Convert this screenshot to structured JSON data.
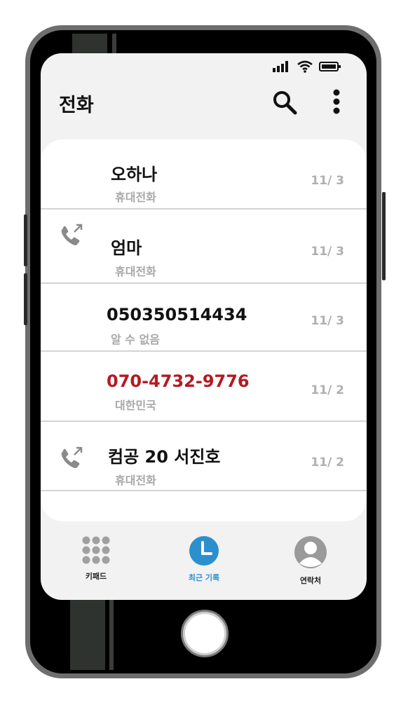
{
  "app": {
    "title": "전화"
  },
  "header": {
    "search_icon": "search-icon",
    "more_icon": "more-vertical-icon"
  },
  "status_bar": {
    "icons": [
      "signal-icon",
      "wifi-icon",
      "battery-icon"
    ]
  },
  "calls": [
    {
      "name": "오하나",
      "type": "휴대전화",
      "date": "11/ 3",
      "outgoing": false,
      "missed": false
    },
    {
      "name": "엄마",
      "type": "휴대전화",
      "date": "11/ 3",
      "outgoing": true,
      "missed": false
    },
    {
      "name": "050350514434",
      "type": "알 수 없음",
      "date": "11/ 3",
      "outgoing": false,
      "missed": false
    },
    {
      "name": "070-4732-9776",
      "type": "대한민국",
      "date": "11/ 2",
      "outgoing": false,
      "missed": true
    },
    {
      "name": "컴공 20 서진호",
      "type": "휴대전화",
      "date": "11/ 2",
      "outgoing": true,
      "missed": false
    }
  ],
  "nav": {
    "keypad": "키패드",
    "recents": "최근 기록",
    "contacts": "연락처",
    "active": "recents"
  },
  "colors": {
    "missed": "#b31b22",
    "accent": "#2c8fce",
    "muted": "#a8a8a8"
  }
}
